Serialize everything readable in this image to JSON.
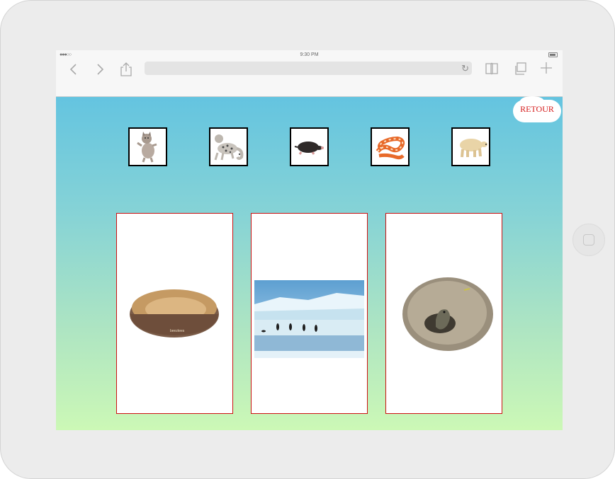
{
  "status_bar": {
    "time": "9:30 PM"
  },
  "browser": {
    "back_icon": "chevron-left-icon",
    "forward_icon": "chevron-right-icon",
    "share_icon": "share-icon",
    "reload_icon": "reload-icon",
    "bookmarks_icon": "book-icon",
    "tabs_icon": "tabs-icon",
    "new_tab_icon": "plus-icon",
    "url": ""
  },
  "page": {
    "retour_label": "RETOUR",
    "animals": [
      {
        "name": "cat",
        "icon": "cat-icon"
      },
      {
        "name": "snow-leopard",
        "icon": "snow-leopard-icon"
      },
      {
        "name": "mole",
        "icon": "mole-icon"
      },
      {
        "name": "snake",
        "icon": "snake-icon"
      },
      {
        "name": "polar-bear",
        "icon": "polar-bear-icon"
      }
    ],
    "habitats": [
      {
        "name": "pet-bed",
        "icon": "pet-bed-image"
      },
      {
        "name": "ice-floe",
        "icon": "ice-floe-image"
      },
      {
        "name": "burrow",
        "icon": "burrow-image"
      }
    ],
    "brand_on_bed": "beeztees"
  },
  "colors": {
    "gradient_top": "#64c4e0",
    "gradient_bottom": "#ccf8b6",
    "retour_text": "#d51c1c",
    "habitat_border": "#cc1111"
  }
}
